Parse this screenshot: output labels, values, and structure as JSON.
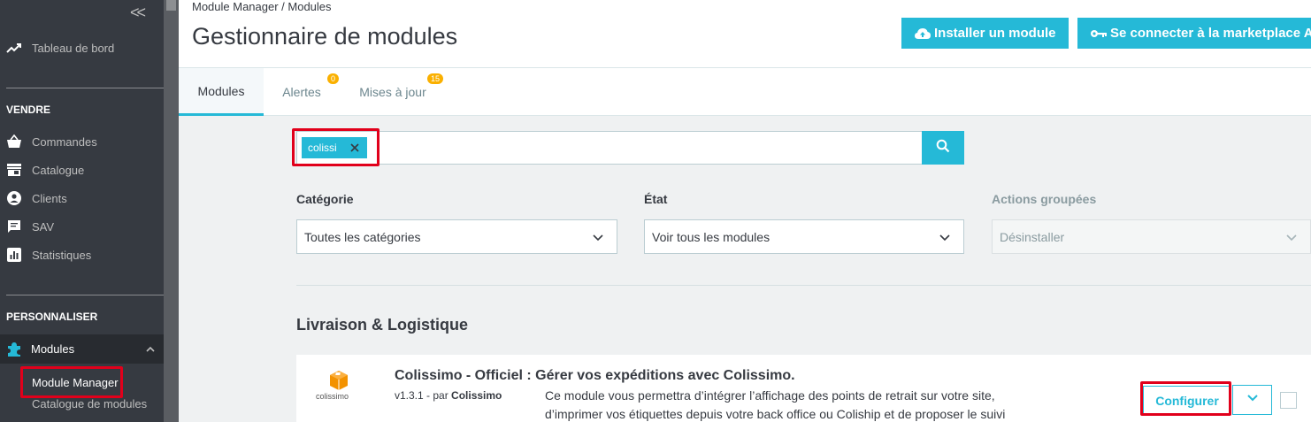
{
  "sidebar": {
    "dashboard": "Tableau de bord",
    "section_sell": "VENDRE",
    "orders": "Commandes",
    "catalog": "Catalogue",
    "customers": "Clients",
    "sav": "SAV",
    "stats": "Statistiques",
    "section_customize": "PERSONNALISER",
    "modules": "Modules",
    "module_manager": "Module Manager",
    "module_catalog": "Catalogue de modules"
  },
  "header": {
    "breadcrumb": "Module Manager  /  Modules",
    "title": "Gestionnaire de modules",
    "install_label": "Installer un module",
    "marketplace_label": "Se connecter à la marketplace Addons"
  },
  "tabs": [
    {
      "label": "Modules"
    },
    {
      "label": "Alertes",
      "badge": "0"
    },
    {
      "label": "Mises à jour",
      "badge": "15"
    }
  ],
  "search": {
    "chip": "colissi"
  },
  "filters": {
    "category_label": "Catégorie",
    "category_value": "Toutes les catégories",
    "state_label": "État",
    "state_value": "Voir tous les modules",
    "bulk_label": "Actions groupées",
    "bulk_value": "Désinstaller"
  },
  "section": {
    "title": "Livraison & Logistique"
  },
  "module": {
    "logo_text": "colissimo",
    "name": "Colissimo - Officiel : Gérer vos expéditions avec Colissimo.",
    "version": "v1.3.1 - par ",
    "author": "Colissimo",
    "description": "Ce module vous permettra d’intégrer l’affichage des points de retrait sur votre site, d’imprimer vos étiquettes depuis votre back office ou Coliship et de proposer le suivi",
    "configure_label": "Configurer"
  },
  "colors": {
    "accent": "#25b9d7",
    "sidebar_bg": "#363a41",
    "highlight": "#e1001b",
    "badge": "#fab000"
  }
}
